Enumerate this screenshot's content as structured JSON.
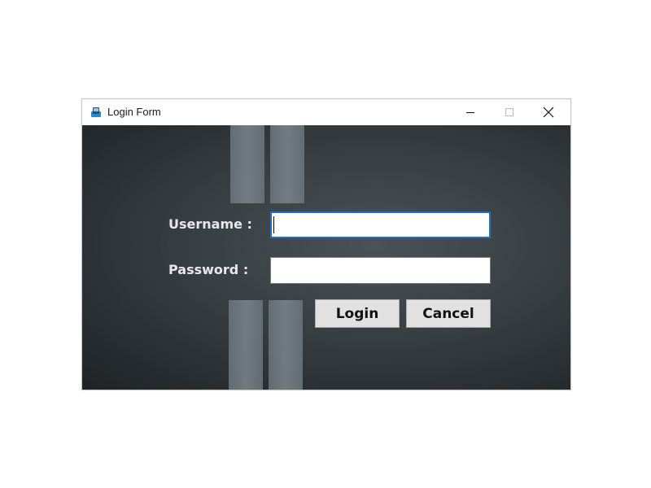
{
  "window": {
    "title": "Login Form",
    "icon": "app-icon",
    "controls": {
      "minimize_icon": "minimize-icon",
      "maximize_icon": "maximize-icon",
      "close_icon": "close-icon"
    }
  },
  "form": {
    "username_label": "Username :",
    "password_label": "Password  :",
    "username_value": "",
    "password_value": "",
    "login_label": "Login",
    "cancel_label": "Cancel"
  },
  "colors": {
    "focus_border": "#1f6fc5",
    "background_dark": "#2a2f33",
    "button_face": "#e1e1e1"
  }
}
